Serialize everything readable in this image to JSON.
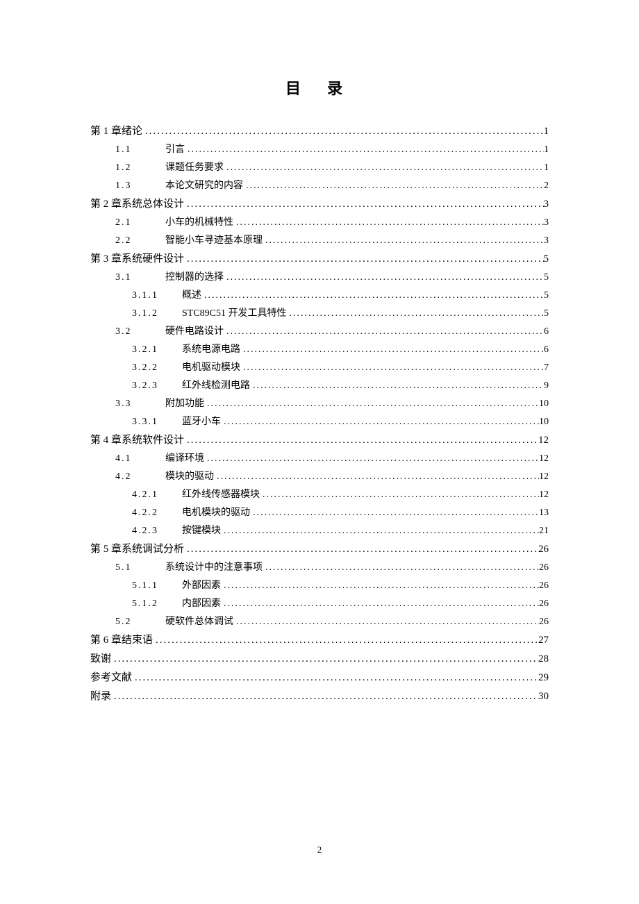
{
  "title": "目  录",
  "page_number": "2",
  "toc": [
    {
      "level": 0,
      "num": "第 1 章",
      "label": " 绪论",
      "page": "1"
    },
    {
      "level": 1,
      "num": "1.1",
      "label": "引言",
      "page": "1"
    },
    {
      "level": 1,
      "num": "1.2",
      "label": "课题任务要求",
      "page": "1"
    },
    {
      "level": 1,
      "num": "1.3",
      "label": "本论文研究的内容",
      "page": "2"
    },
    {
      "level": 0,
      "num": "第 2 章",
      "label": " 系统总体设计",
      "page": "3"
    },
    {
      "level": 1,
      "num": "2.1",
      "label": "小车的机械特性",
      "page": "3"
    },
    {
      "level": 1,
      "num": "2.2",
      "label": "智能小车寻迹基本原理",
      "page": "3"
    },
    {
      "level": 0,
      "num": "第 3 章",
      "label": " 系统硬件设计",
      "page": "5"
    },
    {
      "level": 1,
      "num": "3.1",
      "label": "控制器的选择",
      "page": "5"
    },
    {
      "level": 2,
      "num": "3.1.1",
      "label": "概述",
      "page": "5"
    },
    {
      "level": 2,
      "num": "3.1.2",
      "label": "STC89C51 开发工具特性 ",
      "page": "5"
    },
    {
      "level": 1,
      "num": "3.2",
      "label": "硬件电路设计",
      "page": "6"
    },
    {
      "level": 2,
      "num": "3.2.1",
      "label": "系统电源电路",
      "page": "6"
    },
    {
      "level": 2,
      "num": "3.2.2",
      "label": "电机驱动模块",
      "page": "7"
    },
    {
      "level": 2,
      "num": "3.2.3",
      "label": "红外线检测电路",
      "page": "9"
    },
    {
      "level": 1,
      "num": "3.3",
      "label": "附加功能 ",
      "page": "10"
    },
    {
      "level": 2,
      "num": "3.3.1",
      "label": "蓝牙小车",
      "page": "10"
    },
    {
      "level": 0,
      "num": "第 4 章",
      "label": " 系统软件设计",
      "page": "12"
    },
    {
      "level": 1,
      "num": "4.1",
      "label": "编译环境",
      "page": "12"
    },
    {
      "level": 1,
      "num": "4.2",
      "label": "模块的驱动",
      "page": "12"
    },
    {
      "level": 2,
      "num": "4.2.1",
      "label": "红外线传感器模块",
      "page": "12"
    },
    {
      "level": 2,
      "num": "4.2.2",
      "label": "电机模块的驱动",
      "page": "13"
    },
    {
      "level": 2,
      "num": "4.2.3",
      "label": "按键模块",
      "page": "21"
    },
    {
      "level": 0,
      "num": "第 5 章",
      "label": " 系统调试分析",
      "page": "26"
    },
    {
      "level": 1,
      "num": "5.1",
      "label": "系统设计中的注意事项",
      "page": "26"
    },
    {
      "level": 2,
      "num": "5.1.1",
      "label": "外部因素",
      "page": "26"
    },
    {
      "level": 2,
      "num": "5.1.2",
      "label": "内部因素",
      "page": "26"
    },
    {
      "level": 1,
      "num": "5.2",
      "label": "硬软件总体调试",
      "page": "26"
    },
    {
      "level": 0,
      "num": "第 6 章",
      "label": " 结束语",
      "page": "27"
    },
    {
      "level": 0,
      "num": "",
      "label": "致谢",
      "page": "28"
    },
    {
      "level": 0,
      "num": "",
      "label": "参考文献",
      "page": "29"
    },
    {
      "level": 0,
      "num": "",
      "label": "附录",
      "page": "30"
    }
  ]
}
